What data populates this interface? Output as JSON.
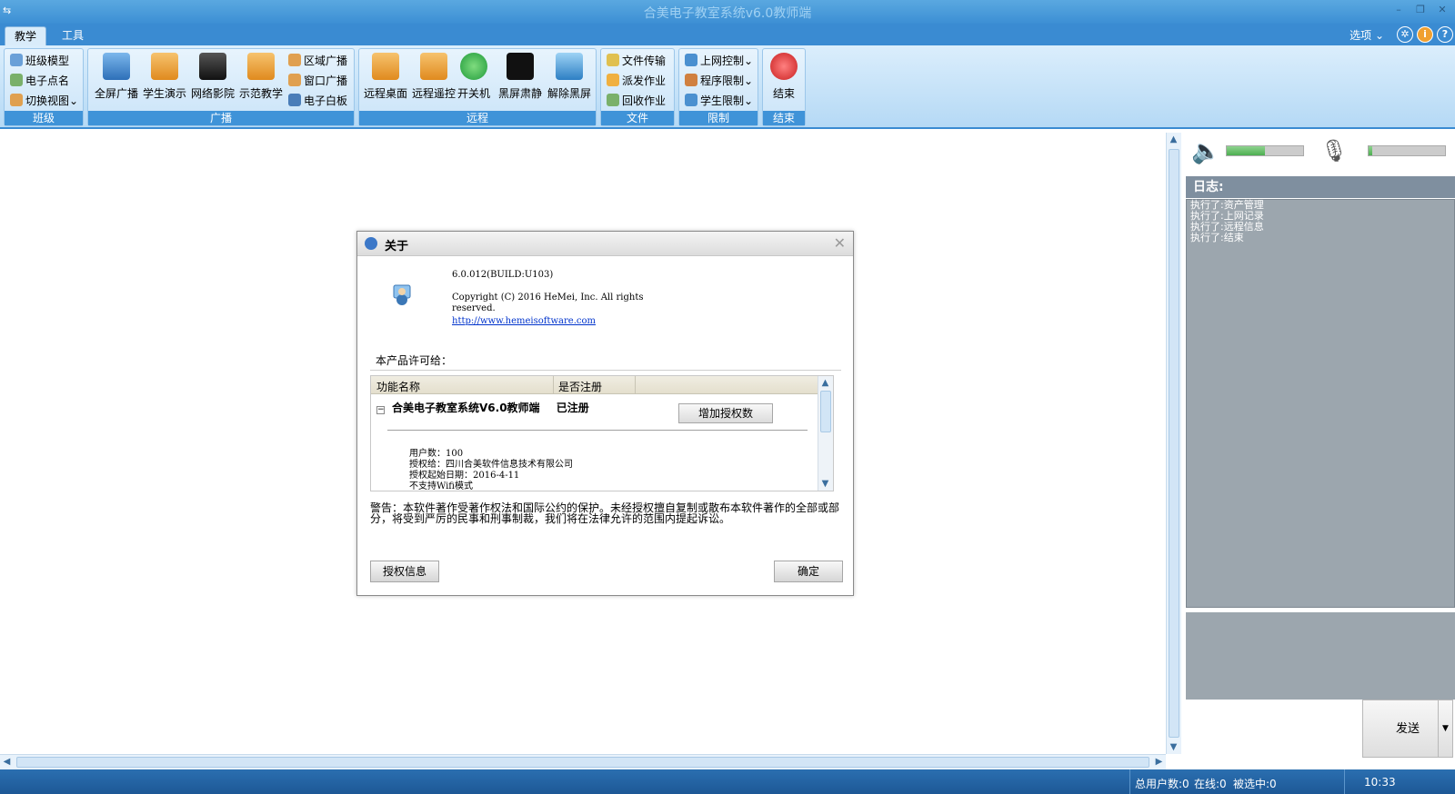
{
  "window": {
    "title": "合美电子教室系统v6.0教师端"
  },
  "menu": {
    "tabs": [
      "教学",
      "工具"
    ],
    "active_tab": "教学",
    "options_label": "选项"
  },
  "ribbon": {
    "class_group": {
      "label": "班级",
      "items": [
        "班级模型",
        "电子点名",
        "切换视图"
      ]
    },
    "broadcast_group": {
      "label": "广播",
      "big_items": [
        "全屏广播",
        "学生演示",
        "网络影院",
        "示范教学"
      ],
      "small_items": [
        "区域广播",
        "窗口广播",
        "电子白板"
      ]
    },
    "remote_group": {
      "label": "远程",
      "items": [
        "远程桌面",
        "远程遥控",
        "开关机",
        "黑屏肃静",
        "解除黑屏"
      ]
    },
    "file_group": {
      "label": "文件",
      "items": [
        "文件传输",
        "派发作业",
        "回收作业"
      ]
    },
    "limit_group": {
      "label": "限制",
      "items": [
        "上网控制",
        "程序限制",
        "学生限制"
      ]
    },
    "end_group": {
      "label": "结束",
      "item": "结束"
    }
  },
  "right_panel": {
    "speaker_volume": 0.5,
    "mic_volume": 0.05,
    "log_title": "日志:",
    "log_lines": [
      "执行了:资产管理",
      "执行了:上网记录",
      "执行了:远程信息",
      "执行了:结束"
    ],
    "send_label": "发送"
  },
  "dialog": {
    "title": "关于",
    "version": "6.0.012(BUILD:U103)",
    "copyright": "Copyright (C) 2016 HeMei, Inc. All rights reserved.",
    "link": "http://www.hemeisoftware.com",
    "license_to_label": "本产品许可给：",
    "columns": [
      "功能名称",
      "是否注册"
    ],
    "row": {
      "name": "合美电子教室系统V6.0教师端",
      "status": "已注册"
    },
    "add_license_label": "增加授权数",
    "details": [
      "用户数：100",
      "授权给：四川合美软件信息技术有限公司",
      "授权起始日期：2016-4-11",
      "不支持Wifi模式"
    ],
    "warning": "警告：本软件著作受著作权法和国际公约的保护。未经授权擅自复制或散布本软件著作的全部或部分，将受到严厉的民事和刑事制裁，我们将在法律允许的范围内提起诉讼。",
    "auth_info_label": "授权信息",
    "ok_label": "确定"
  },
  "status_bar": {
    "total_users": "总用户数:0",
    "online": "在线:0",
    "selected": "被选中:0",
    "time": "10:33"
  }
}
